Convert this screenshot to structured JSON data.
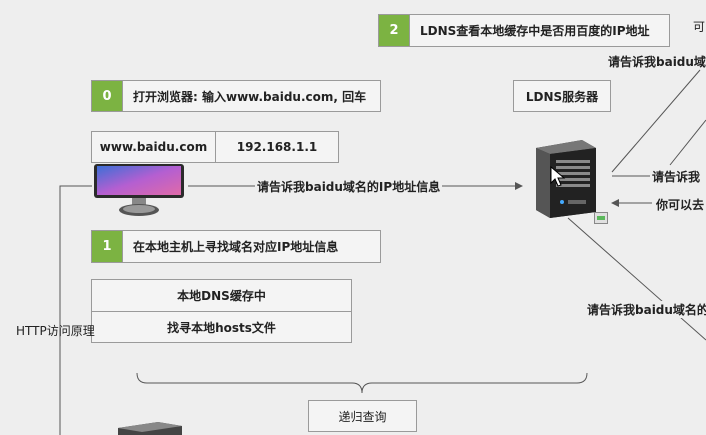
{
  "steps": [
    {
      "num": "0",
      "text": "打开浏览器: 输入www.baidu.com, 回车"
    },
    {
      "num": "1",
      "text": "在本地主机上寻找域名对应IP地址信息"
    },
    {
      "num": "2",
      "text": "LDNS查看本地缓存中是否用百度的IP地址"
    }
  ],
  "host_table": {
    "domain": "www.baidu.com",
    "ip": "192.168.1.1"
  },
  "ldns_label": "LDNS服务器",
  "lookup_list": [
    "本地DNS缓存中",
    "找寻本地hosts文件"
  ],
  "recursive_label": "递归查询",
  "side_label": "HTTP访问原理",
  "messages": {
    "host_to_ldns": "请告诉我baidu域名的IP地址信息",
    "ldns_to_root_top": "请告诉我baidu域",
    "ldns_to_root_mid": "请告诉我",
    "reply": "你可以去",
    "ldns_to_lower": "请告诉我baidu域名的",
    "corner": "可"
  }
}
